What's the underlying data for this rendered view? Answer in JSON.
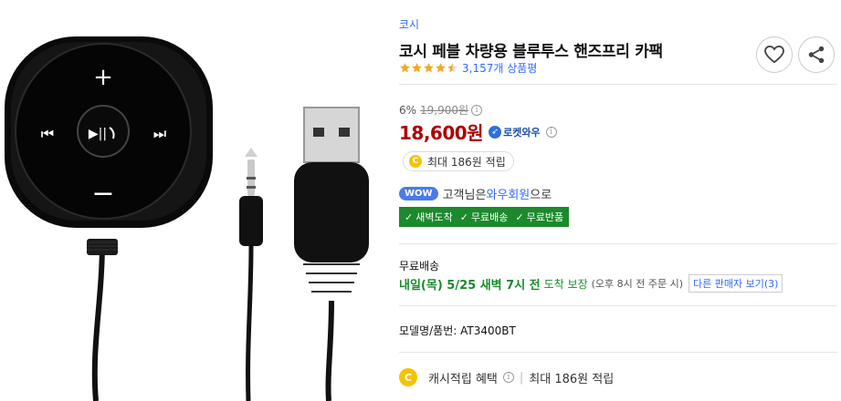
{
  "product": {
    "brand": "코시",
    "title": "코시 페블 차량용 블루투스 핸즈프리 카팩",
    "image_alt": "코시 페블 블루투스 핸즈프리 카팩 제품 이미지",
    "rating": 4.5,
    "review_count": "3,157개 상품평"
  },
  "price": {
    "discount_rate": "6%",
    "original_price": "19,900원",
    "sale_price": "18,600원",
    "rocket_label": "로켓와우"
  },
  "cash": {
    "pill_label": "최대 186원 적립"
  },
  "wow": {
    "badge": "WOW",
    "text_prefix": "고객님은 ",
    "link": "와우회원",
    "text_suffix": "으로"
  },
  "benefits": [
    "새벽도착",
    "무료배송",
    "무료반품"
  ],
  "shipping": {
    "label": "무료배송",
    "date": "내일(목) 5/25 새벽 7시 전",
    "guarantee": "도착 보장",
    "note": "(오후 8시 전 주문 시)",
    "other_sellers": "다른 판매자 보기(3)"
  },
  "model": {
    "text": "모델명/품번:  AT3400BT"
  },
  "cash_benefit": {
    "label": "캐시적립 혜택",
    "value": "최대 186원 적립"
  },
  "icons": {
    "favorite": "heart-icon",
    "share": "share-icon",
    "coin": "C"
  },
  "colors": {
    "accent_blue": "#346aff",
    "price_red": "#ae0000",
    "benefit_green": "#1b8a2c",
    "star": "#f5a623"
  }
}
